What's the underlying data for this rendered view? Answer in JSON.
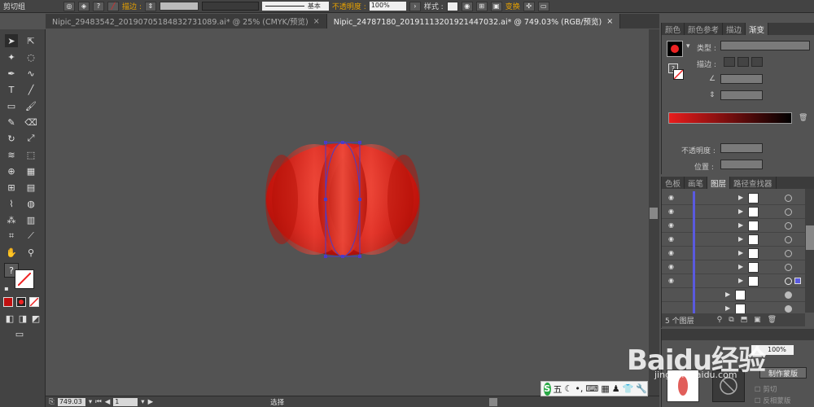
{
  "control_bar": {
    "selection_label": "剪切组",
    "stroke_label": "描边 :",
    "stroke_style": "基本",
    "opacity_label": "不透明度 :",
    "opacity_value": "100%",
    "style_label": "样式 :",
    "transform_label": "变换"
  },
  "tabs": [
    {
      "label": "Nipic_29483542_20190705184832731089.ai* @ 25% (CMYK/预览)",
      "active": false
    },
    {
      "label": "Nipic_24787180_20191113201921447032.ai* @ 749.03% (RGB/预览)",
      "active": true
    }
  ],
  "status": {
    "zoom": "749.03",
    "page": "1",
    "mode": "选择"
  },
  "panel_top": {
    "tabs": [
      "颜色",
      "颜色参考",
      "描边",
      "渐变"
    ],
    "active_tab": "渐变",
    "type_label": "类型 :",
    "stroke_label": "描边 :",
    "opacity_label": "不透明度 :",
    "position_label": "位置 :",
    "gradient_start": "#e81c1c",
    "gradient_end": "#000000"
  },
  "panel_layers": {
    "tabs": [
      "色板",
      "画笔",
      "图层",
      "路径查找器"
    ],
    "active_tab": "图层",
    "footer_count": "5 个图层",
    "layer_accent": "#5a5adf"
  },
  "panel_bottom": {
    "make_mask_label": "制作蒙版",
    "clip_label": "剪切",
    "invert_label": "反相蒙版"
  },
  "ime": {
    "logo": "S",
    "label": "五"
  },
  "watermark": {
    "brand": "Baidu经验",
    "url": "jingyan.baidu.com"
  },
  "artwork": {
    "fill_main": "#d41a14",
    "fill_highlight": "#f04a3a",
    "path_color": "#4a3cc8"
  }
}
